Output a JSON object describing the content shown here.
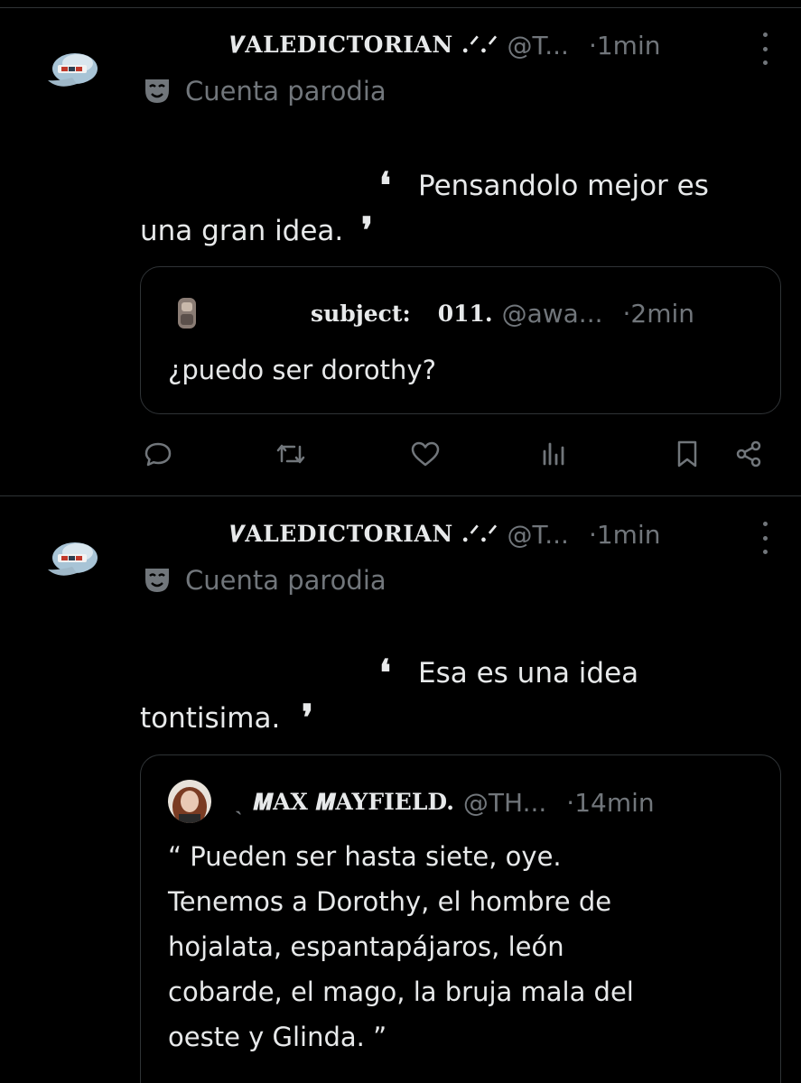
{
  "timeline": {
    "tweets": [
      {
        "display_name": "𝑽ALEDICTORIAN .ᐟ.ᐟ",
        "handle": "@T...",
        "separator": "·",
        "time": "1min",
        "parody_label": "Cuenta parodia",
        "text_line1": "Pensandolo mejor es",
        "text_line2": "una gran idea.",
        "quote": {
          "name_part1": "subject:",
          "name_part2": "011.",
          "handle": "@awa...",
          "separator": "·",
          "time": "2min",
          "text": "¿puedo  ser  dorothy?"
        }
      },
      {
        "display_name": "𝑽ALEDICTORIAN .ᐟ.ᐟ",
        "handle": "@T...",
        "separator": "·",
        "time": "1min",
        "parody_label": "Cuenta parodia",
        "text_line1": "Esa es una idea",
        "text_line2": "tontisima.",
        "quote": {
          "name_prefix": "ˎ",
          "name": "𝑴AX 𝑴AYFIELD.",
          "handle": "@TH...",
          "separator": "·",
          "time": "14min",
          "text": "“ Pueden ser hasta siete, oye.\nTenemos a Dorothy, el hombre de\nhojalata, espantapájaros, león\ncobarde, el mago, la bruja mala del\noeste y Glinda. ”"
        }
      }
    ]
  },
  "colors": {
    "background": "#000000",
    "text": "#e7e9ea",
    "secondary": "#71767b",
    "border": "#2f3336"
  },
  "icons": [
    "cap-avatar",
    "mask-icon",
    "more-icon",
    "reply-icon",
    "retweet-icon",
    "like-icon",
    "views-icon",
    "bookmark-icon",
    "share-icon"
  ]
}
